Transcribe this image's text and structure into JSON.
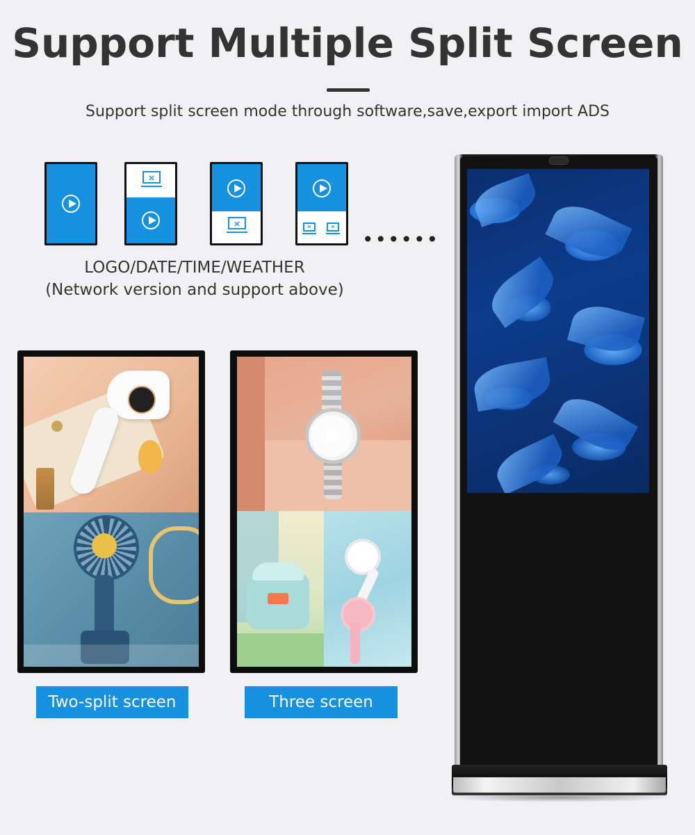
{
  "header": {
    "title": "Support Multiple Split Screen",
    "subtitle": "Support split screen mode through software,save,export import ADS"
  },
  "modes": {
    "ellipsis": "••••••",
    "note_line1": "LOGO/DATE/TIME/WEATHER",
    "note_line2": "(Network version and support above)",
    "icons": [
      "play-icon",
      "image-icon"
    ]
  },
  "examples": {
    "two_split_label": "Two-split screen",
    "three_label": "Three screen"
  },
  "colors": {
    "accent_blue": "#1591df",
    "background": "#f1f1f3",
    "title_text": "#333333"
  }
}
